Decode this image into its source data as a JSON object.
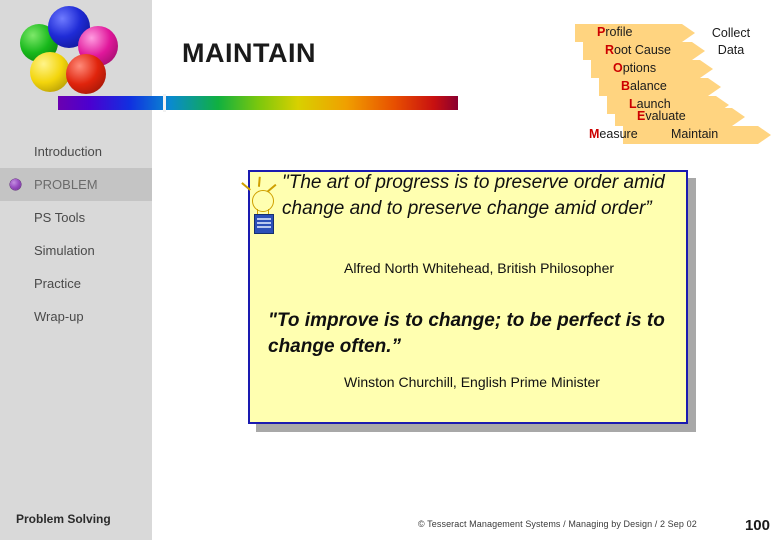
{
  "slide": {
    "title": "MAINTAIN",
    "page_number": "100",
    "footer_credit": "© Tesseract Management Systems / Managing by Design / 2 Sep 02",
    "sidebar_footer": "Problem Solving"
  },
  "sidebar": {
    "items": [
      {
        "label": "Introduction",
        "active": false,
        "bullet": false
      },
      {
        "label": "PROBLEM",
        "active": true,
        "bullet": true
      },
      {
        "label": "PS Tools",
        "active": false,
        "bullet": false
      },
      {
        "label": "Simulation",
        "active": false,
        "bullet": false
      },
      {
        "label": "Practice",
        "active": false,
        "bullet": false
      },
      {
        "label": "Wrap-up",
        "active": false,
        "bullet": false
      }
    ]
  },
  "process_chevrons": {
    "collect_data": "Collect\nData",
    "collect_data_line1": "Collect",
    "collect_data_line2": "Data",
    "steps": [
      {
        "initial": "P",
        "rest": "rofile"
      },
      {
        "initial": "R",
        "rest": "oot Cause"
      },
      {
        "initial": "O",
        "rest": "ptions"
      },
      {
        "initial": "B",
        "rest": "alance"
      },
      {
        "initial": "L",
        "rest": "aunch"
      },
      {
        "initial": "E",
        "rest": "valuate"
      },
      {
        "initial": "M",
        "rest": "easure"
      }
    ],
    "last_label": "Maintain"
  },
  "content": {
    "quote1": "\"The art of progress is to preserve order amid change and to preserve change amid order”",
    "attribution1": "Alfred North Whitehead, British Philosopher",
    "quote2": "\"To improve is to change; to be perfect is to change often.”",
    "attribution2": "Winston Churchill, English Prime Minister"
  },
  "colors": {
    "accent_red": "#cc0000",
    "chevron_fill": "#ffd480",
    "content_fill": "#ffffb0",
    "content_border": "#1a1ab0",
    "sidebar_bg": "#d9d9d9"
  },
  "icons": {
    "lightbulb": "lightbulb-icon"
  }
}
